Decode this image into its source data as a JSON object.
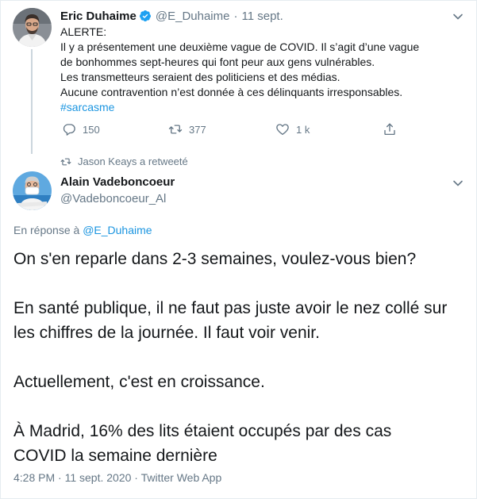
{
  "parent_tweet": {
    "author_name": "Eric Duhaime",
    "handle": "@E_Duhaime",
    "separator": "·",
    "date": "11 sept.",
    "lines": [
      "ALERTE:",
      "Il y a présentement une deuxième vague de COVID. Il s’agit d’une vague",
      "de bonhommes sept-heures qui font peur aux gens vulnérables.",
      "Les transmetteurs seraient des politiciens et des médias.",
      "Aucune contravention n’est donnée à ces délinquants irresponsables."
    ],
    "hashtag": "#sarcasme",
    "reply_count": "150",
    "retweet_count": "377",
    "like_count": "1 k"
  },
  "retweet_context": {
    "text": "Jason Keays a retweeté"
  },
  "main_tweet": {
    "author_name": "Alain Vadeboncoeur",
    "handle": "@Vadeboncoeur_Al",
    "reply_prefix": "En réponse à",
    "reply_target": "@E_Duhaime",
    "paragraphs": [
      [
        "On s'en reparle dans 2-3 semaines, voulez-vous bien?"
      ],
      [
        "En santé publique, il ne faut pas juste avoir le nez collé sur",
        "les chiffres de la journée. Il faut voir venir."
      ],
      [
        "Actuellement, c'est en croissance."
      ],
      [
        "À Madrid, 16% des lits étaient occupés par des cas",
        "COVID la semaine dernière"
      ]
    ],
    "timestamp": "4:28 PM · 11 sept. 2020 · Twitter Web App"
  },
  "icons": {
    "verified": "verified-badge-icon",
    "reply": "reply-icon",
    "retweet": "retweet-icon",
    "like": "heart-icon",
    "share": "share-icon",
    "more": "chevron-down-icon"
  },
  "colors": {
    "link": "#1b95e0",
    "secondary_text": "#657786",
    "primary_text": "#14171a",
    "thread_line": "#ccd6dd"
  }
}
